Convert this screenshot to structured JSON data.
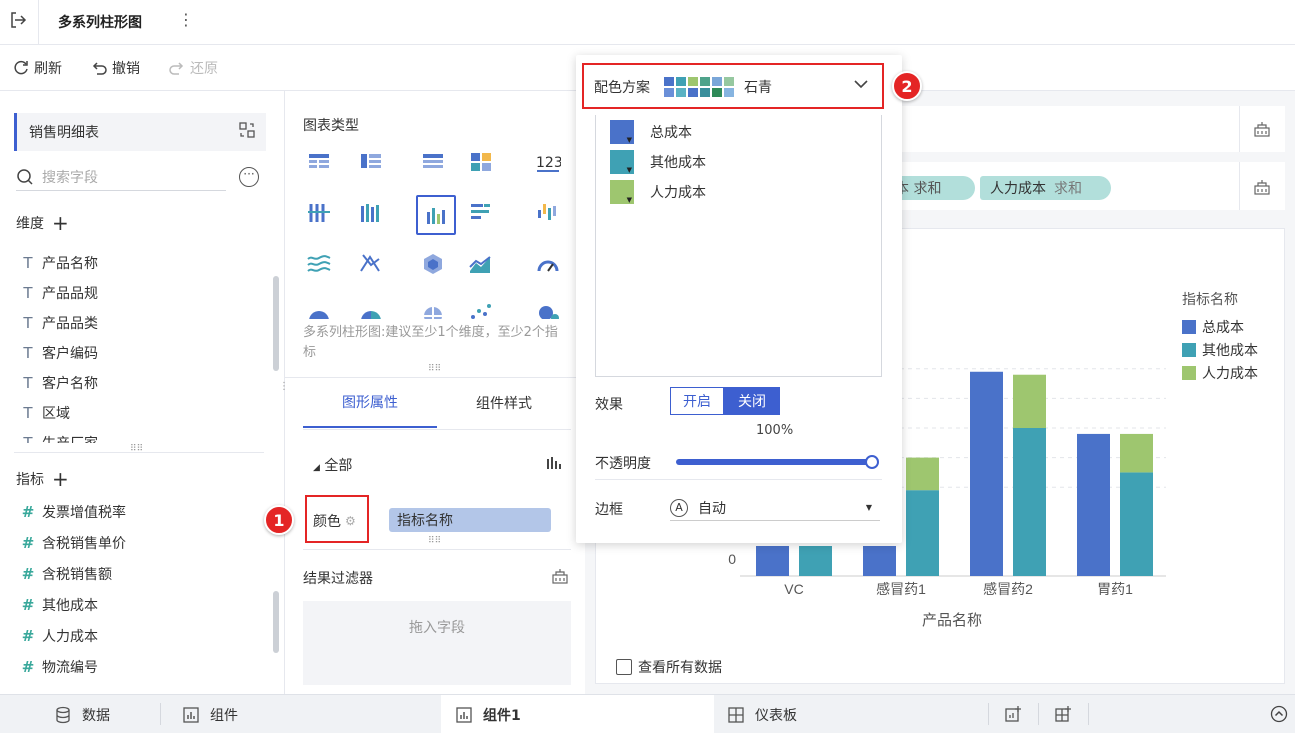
{
  "header": {
    "title": "多系列柱形图"
  },
  "toolbar": {
    "refresh": "刷新",
    "undo": "撤销",
    "redo": "还原"
  },
  "left": {
    "dataset": "销售明细表",
    "search_placeholder": "搜索字段",
    "dimensions_label": "维度",
    "dimensions": [
      "产品名称",
      "产品品规",
      "产品品类",
      "客户编码",
      "客户名称",
      "区域",
      "生产厂家"
    ],
    "measures_label": "指标",
    "measures": [
      "发票增值税率",
      "含税销售单价",
      "含税销售额",
      "其他成本",
      "人力成本",
      "物流编号"
    ]
  },
  "mid": {
    "chart_type_label": "图表类型",
    "chart_hint": "多系列柱形图:建议至少1个维度，至少2个指标",
    "tabs": [
      "图形属性",
      "组件样式"
    ],
    "all_label": "全部",
    "color_label": "颜色",
    "color_field": "指标名称",
    "filter_label": "结果过滤器",
    "drop_hint": "拖入字段"
  },
  "popup": {
    "scheme_label": "配色方案",
    "scheme_name": "石青",
    "series": [
      {
        "name": "总成本",
        "color": "#4a72c9"
      },
      {
        "name": "其他成本",
        "color": "#3fa1b4"
      },
      {
        "name": "人力成本",
        "color": "#9ec66f"
      }
    ],
    "effect_label": "效果",
    "effect_on": "开启",
    "effect_off": "关闭",
    "opacity_value": "100%",
    "opacity_label": "不透明度",
    "border_label": "边框",
    "border_value": "自动"
  },
  "right": {
    "pill_partial": "本 求和",
    "pill_labor": "人力成本",
    "pill_agg": "求和",
    "show_all": "查看所有数据"
  },
  "chart_data": {
    "type": "bar",
    "categories": [
      "VC",
      "感冒药1",
      "感冒药2",
      "胃药1"
    ],
    "series": [
      {
        "name": "总成本",
        "values": [
          null,
          null,
          6.9,
          4.8
        ]
      },
      {
        "name": "其他成本",
        "values": [
          null,
          2.9,
          5.0,
          3.5
        ]
      },
      {
        "name": "人力成本",
        "values": [
          null,
          1.1,
          1.8,
          1.3
        ]
      }
    ],
    "xlabel": "产品名称",
    "legend_title": "指标名称",
    "y_tick": "0"
  },
  "annotations": {
    "badge1": "1",
    "badge2": "2"
  },
  "bottom": {
    "tabs": [
      "数据",
      "组件",
      "组件1",
      "仪表板"
    ]
  }
}
